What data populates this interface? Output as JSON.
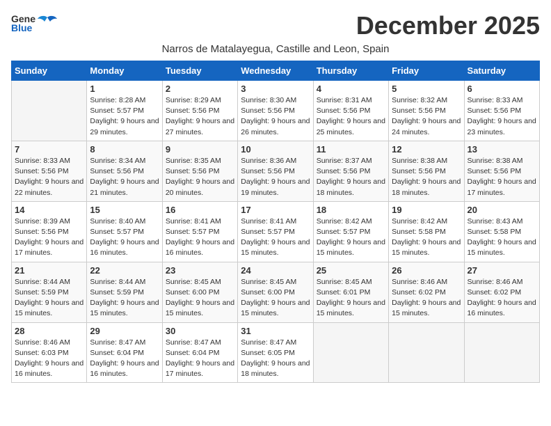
{
  "header": {
    "logo_general": "General",
    "logo_blue": "Blue",
    "month_title": "December 2025",
    "location": "Narros de Matalayegua, Castille and Leon, Spain"
  },
  "weekdays": [
    "Sunday",
    "Monday",
    "Tuesday",
    "Wednesday",
    "Thursday",
    "Friday",
    "Saturday"
  ],
  "weeks": [
    [
      {
        "day": "",
        "sunrise": "",
        "sunset": "",
        "daylight": ""
      },
      {
        "day": "1",
        "sunrise": "Sunrise: 8:28 AM",
        "sunset": "Sunset: 5:57 PM",
        "daylight": "Daylight: 9 hours and 29 minutes."
      },
      {
        "day": "2",
        "sunrise": "Sunrise: 8:29 AM",
        "sunset": "Sunset: 5:56 PM",
        "daylight": "Daylight: 9 hours and 27 minutes."
      },
      {
        "day": "3",
        "sunrise": "Sunrise: 8:30 AM",
        "sunset": "Sunset: 5:56 PM",
        "daylight": "Daylight: 9 hours and 26 minutes."
      },
      {
        "day": "4",
        "sunrise": "Sunrise: 8:31 AM",
        "sunset": "Sunset: 5:56 PM",
        "daylight": "Daylight: 9 hours and 25 minutes."
      },
      {
        "day": "5",
        "sunrise": "Sunrise: 8:32 AM",
        "sunset": "Sunset: 5:56 PM",
        "daylight": "Daylight: 9 hours and 24 minutes."
      },
      {
        "day": "6",
        "sunrise": "Sunrise: 8:33 AM",
        "sunset": "Sunset: 5:56 PM",
        "daylight": "Daylight: 9 hours and 23 minutes."
      }
    ],
    [
      {
        "day": "7",
        "sunrise": "Sunrise: 8:33 AM",
        "sunset": "Sunset: 5:56 PM",
        "daylight": "Daylight: 9 hours and 22 minutes."
      },
      {
        "day": "8",
        "sunrise": "Sunrise: 8:34 AM",
        "sunset": "Sunset: 5:56 PM",
        "daylight": "Daylight: 9 hours and 21 minutes."
      },
      {
        "day": "9",
        "sunrise": "Sunrise: 8:35 AM",
        "sunset": "Sunset: 5:56 PM",
        "daylight": "Daylight: 9 hours and 20 minutes."
      },
      {
        "day": "10",
        "sunrise": "Sunrise: 8:36 AM",
        "sunset": "Sunset: 5:56 PM",
        "daylight": "Daylight: 9 hours and 19 minutes."
      },
      {
        "day": "11",
        "sunrise": "Sunrise: 8:37 AM",
        "sunset": "Sunset: 5:56 PM",
        "daylight": "Daylight: 9 hours and 18 minutes."
      },
      {
        "day": "12",
        "sunrise": "Sunrise: 8:38 AM",
        "sunset": "Sunset: 5:56 PM",
        "daylight": "Daylight: 9 hours and 18 minutes."
      },
      {
        "day": "13",
        "sunrise": "Sunrise: 8:38 AM",
        "sunset": "Sunset: 5:56 PM",
        "daylight": "Daylight: 9 hours and 17 minutes."
      }
    ],
    [
      {
        "day": "14",
        "sunrise": "Sunrise: 8:39 AM",
        "sunset": "Sunset: 5:56 PM",
        "daylight": "Daylight: 9 hours and 17 minutes."
      },
      {
        "day": "15",
        "sunrise": "Sunrise: 8:40 AM",
        "sunset": "Sunset: 5:57 PM",
        "daylight": "Daylight: 9 hours and 16 minutes."
      },
      {
        "day": "16",
        "sunrise": "Sunrise: 8:41 AM",
        "sunset": "Sunset: 5:57 PM",
        "daylight": "Daylight: 9 hours and 16 minutes."
      },
      {
        "day": "17",
        "sunrise": "Sunrise: 8:41 AM",
        "sunset": "Sunset: 5:57 PM",
        "daylight": "Daylight: 9 hours and 15 minutes."
      },
      {
        "day": "18",
        "sunrise": "Sunrise: 8:42 AM",
        "sunset": "Sunset: 5:57 PM",
        "daylight": "Daylight: 9 hours and 15 minutes."
      },
      {
        "day": "19",
        "sunrise": "Sunrise: 8:42 AM",
        "sunset": "Sunset: 5:58 PM",
        "daylight": "Daylight: 9 hours and 15 minutes."
      },
      {
        "day": "20",
        "sunrise": "Sunrise: 8:43 AM",
        "sunset": "Sunset: 5:58 PM",
        "daylight": "Daylight: 9 hours and 15 minutes."
      }
    ],
    [
      {
        "day": "21",
        "sunrise": "Sunrise: 8:44 AM",
        "sunset": "Sunset: 5:59 PM",
        "daylight": "Daylight: 9 hours and 15 minutes."
      },
      {
        "day": "22",
        "sunrise": "Sunrise: 8:44 AM",
        "sunset": "Sunset: 5:59 PM",
        "daylight": "Daylight: 9 hours and 15 minutes."
      },
      {
        "day": "23",
        "sunrise": "Sunrise: 8:45 AM",
        "sunset": "Sunset: 6:00 PM",
        "daylight": "Daylight: 9 hours and 15 minutes."
      },
      {
        "day": "24",
        "sunrise": "Sunrise: 8:45 AM",
        "sunset": "Sunset: 6:00 PM",
        "daylight": "Daylight: 9 hours and 15 minutes."
      },
      {
        "day": "25",
        "sunrise": "Sunrise: 8:45 AM",
        "sunset": "Sunset: 6:01 PM",
        "daylight": "Daylight: 9 hours and 15 minutes."
      },
      {
        "day": "26",
        "sunrise": "Sunrise: 8:46 AM",
        "sunset": "Sunset: 6:02 PM",
        "daylight": "Daylight: 9 hours and 15 minutes."
      },
      {
        "day": "27",
        "sunrise": "Sunrise: 8:46 AM",
        "sunset": "Sunset: 6:02 PM",
        "daylight": "Daylight: 9 hours and 16 minutes."
      }
    ],
    [
      {
        "day": "28",
        "sunrise": "Sunrise: 8:46 AM",
        "sunset": "Sunset: 6:03 PM",
        "daylight": "Daylight: 9 hours and 16 minutes."
      },
      {
        "day": "29",
        "sunrise": "Sunrise: 8:47 AM",
        "sunset": "Sunset: 6:04 PM",
        "daylight": "Daylight: 9 hours and 16 minutes."
      },
      {
        "day": "30",
        "sunrise": "Sunrise: 8:47 AM",
        "sunset": "Sunset: 6:04 PM",
        "daylight": "Daylight: 9 hours and 17 minutes."
      },
      {
        "day": "31",
        "sunrise": "Sunrise: 8:47 AM",
        "sunset": "Sunset: 6:05 PM",
        "daylight": "Daylight: 9 hours and 18 minutes."
      },
      {
        "day": "",
        "sunrise": "",
        "sunset": "",
        "daylight": ""
      },
      {
        "day": "",
        "sunrise": "",
        "sunset": "",
        "daylight": ""
      },
      {
        "day": "",
        "sunrise": "",
        "sunset": "",
        "daylight": ""
      }
    ]
  ]
}
